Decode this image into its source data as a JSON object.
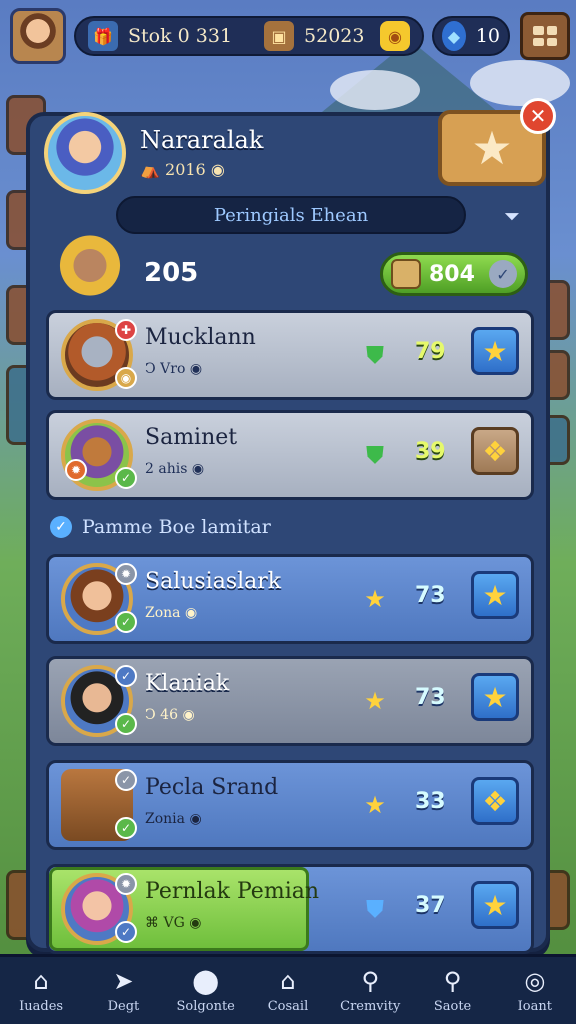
{
  "topbar": {
    "resource1_label": "Stok 0 331",
    "resource2_value": "52023",
    "resource3_value": "10"
  },
  "hero": {
    "name": "Nararalak",
    "sub": "2016"
  },
  "tab_label": "Peringials Ehean",
  "me": {
    "score": "205",
    "points": "804"
  },
  "rows_top": [
    {
      "name": "Mucklann",
      "sub": "Vro",
      "value": "79",
      "rank_icon": "shield-icon",
      "action": "star-icon",
      "style": "gray"
    },
    {
      "name": "Saminet",
      "sub": "2 ahis",
      "value": "39",
      "rank_icon": "shield-icon",
      "action": "emblem-icon",
      "style": "gray"
    }
  ],
  "section_title": "Pamme Boe lamitar",
  "rows_bottom": [
    {
      "name": "Salusiaslark",
      "sub": "Zona",
      "value": "73",
      "action": "star-icon",
      "style": "blue"
    },
    {
      "name": "Klaniak",
      "sub": "46",
      "value": "73",
      "action": "star-icon",
      "style": "gray"
    },
    {
      "name": "Pecla Srand",
      "sub": "Zonia",
      "value": "33",
      "action": "emblem-icon",
      "style": "blue"
    },
    {
      "name": "Pernlak Pemian",
      "sub": "VG",
      "value": "37",
      "action": "star-icon",
      "style": "highlight"
    }
  ],
  "nav": [
    {
      "label": "Iuades",
      "icon": "home-icon"
    },
    {
      "label": "Degt",
      "icon": "send-icon"
    },
    {
      "label": "Solgonte",
      "icon": "map-pin-icon"
    },
    {
      "label": "Cosail",
      "icon": "house-icon"
    },
    {
      "label": "Cremvity",
      "icon": "search-icon"
    },
    {
      "label": "Saote",
      "icon": "magnifier-icon"
    },
    {
      "label": "Ioant",
      "icon": "target-icon"
    }
  ],
  "colors": {
    "panel": "#2e4776",
    "row_gray": "#b6bfcd",
    "row_blue": "#5a83c9",
    "highlight_green": "#8ed055",
    "star_yellow": "#ffd23c"
  }
}
